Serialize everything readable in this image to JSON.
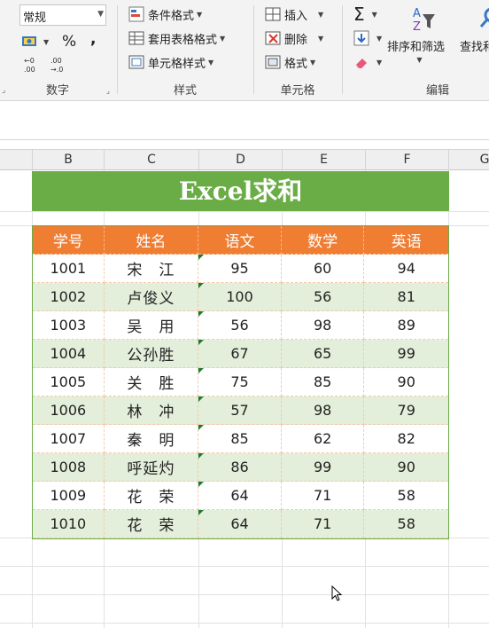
{
  "ribbon": {
    "number_group": {
      "format_value": "常规",
      "percent": "%",
      "comma": ",",
      "label": "数字"
    },
    "styles_group": {
      "conditional_formatting": "条件格式",
      "format_as_table": "套用表格格式",
      "cell_styles": "单元格样式",
      "label": "样式"
    },
    "cells_group": {
      "insert": "插入",
      "delete": "删除",
      "format": "格式",
      "label": "单元格"
    },
    "editing_group": {
      "sort_filter": "排序和筛选",
      "find_select": "查找和",
      "label": "编辑"
    }
  },
  "sheet": {
    "columns": [
      "B",
      "C",
      "D",
      "E",
      "F",
      "G"
    ],
    "title": "Excel求和",
    "headers": [
      "学号",
      "姓名",
      "语文",
      "数学",
      "英语"
    ],
    "rows": [
      {
        "id": "1001",
        "name": "宋　江",
        "chinese": "95",
        "math": "60",
        "english": "94"
      },
      {
        "id": "1002",
        "name": "卢俊义",
        "chinese": "100",
        "math": "56",
        "english": "81"
      },
      {
        "id": "1003",
        "name": "吴　用",
        "chinese": "56",
        "math": "98",
        "english": "89"
      },
      {
        "id": "1004",
        "name": "公孙胜",
        "chinese": "67",
        "math": "65",
        "english": "99"
      },
      {
        "id": "1005",
        "name": "关　胜",
        "chinese": "75",
        "math": "85",
        "english": "90"
      },
      {
        "id": "1006",
        "name": "林　冲",
        "chinese": "57",
        "math": "98",
        "english": "79"
      },
      {
        "id": "1007",
        "name": "秦　明",
        "chinese": "85",
        "math": "62",
        "english": "82"
      },
      {
        "id": "1008",
        "name": "呼延灼",
        "chinese": "86",
        "math": "99",
        "english": "90"
      },
      {
        "id": "1009",
        "name": "花　荣",
        "chinese": "64",
        "math": "71",
        "english": "58"
      },
      {
        "id": "1010",
        "name": "花　荣",
        "chinese": "64",
        "math": "71",
        "english": "58"
      }
    ]
  },
  "colors": {
    "title_green": "#6aac46",
    "header_orange": "#ef7d32",
    "band_green": "#e3efda",
    "error_triangle": "#1e7b34"
  }
}
